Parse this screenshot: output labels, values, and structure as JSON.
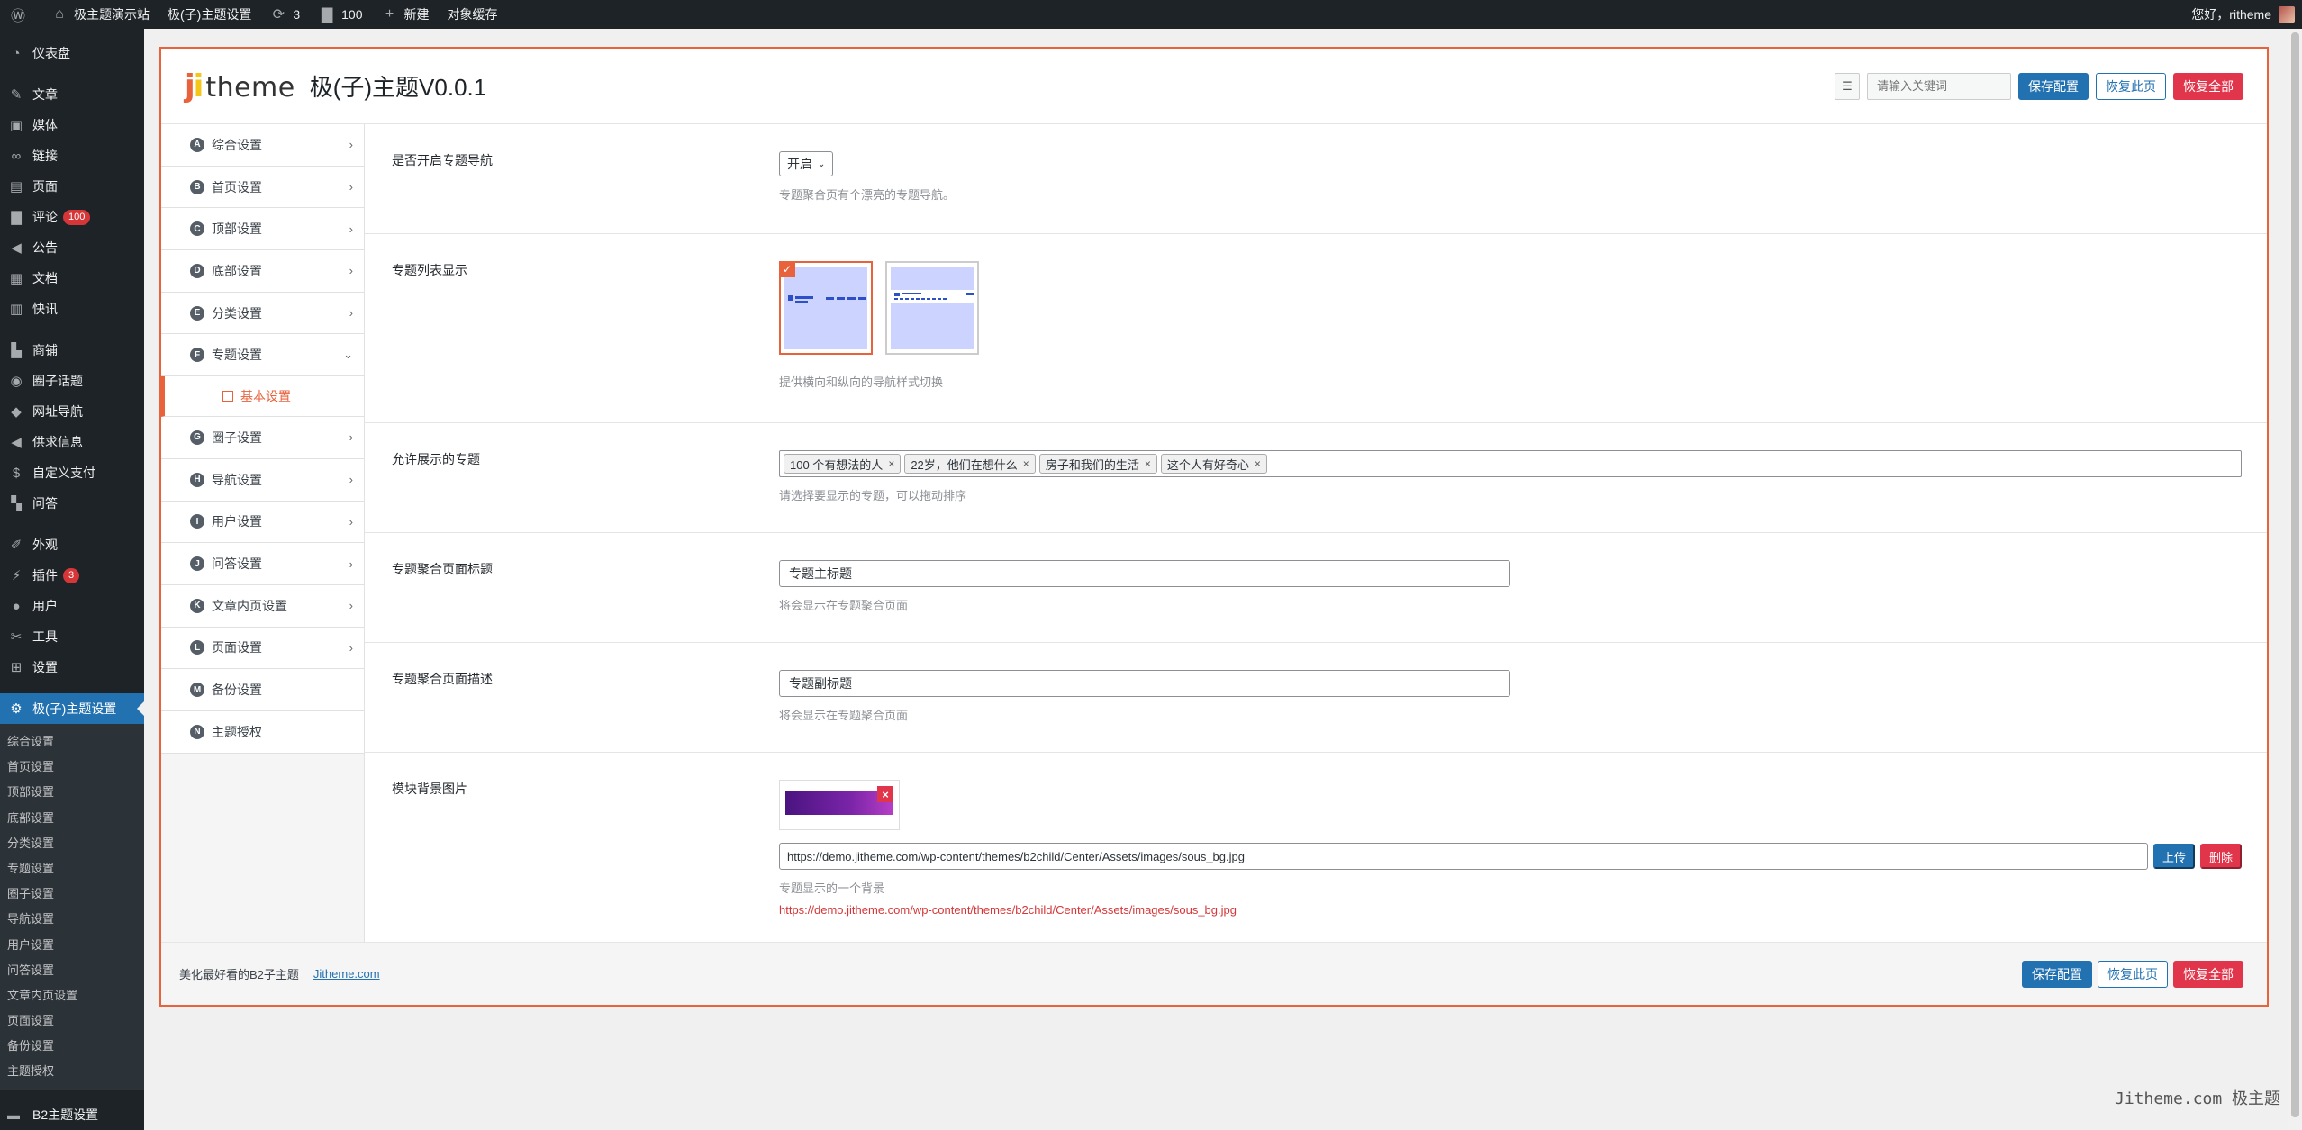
{
  "adminbar": {
    "site_name": "极主题演示站",
    "theme_settings": "极(子)主题设置",
    "updates": "3",
    "comments": "100",
    "new_label": "新建",
    "cache_label": "对象缓存",
    "greeting": "您好，ritheme"
  },
  "menu": {
    "items": [
      {
        "label": "仪表盘",
        "icon": "dashboard-icon"
      },
      {
        "label": "文章",
        "icon": "pin-icon"
      },
      {
        "label": "媒体",
        "icon": "media-icon"
      },
      {
        "label": "链接",
        "icon": "link-icon"
      },
      {
        "label": "页面",
        "icon": "page-icon"
      },
      {
        "label": "评论",
        "icon": "comment-icon",
        "badge": "100"
      },
      {
        "label": "公告",
        "icon": "megaphone-icon"
      },
      {
        "label": "文档",
        "icon": "document-icon"
      },
      {
        "label": "快讯",
        "icon": "flash-icon"
      },
      {
        "label": "商铺",
        "icon": "store-icon"
      },
      {
        "label": "圈子话题",
        "icon": "circle-icon"
      },
      {
        "label": "网址导航",
        "icon": "bus-icon"
      },
      {
        "label": "供求信息",
        "icon": "megaphone-icon"
      },
      {
        "label": "自定义支付",
        "icon": "dollar-icon"
      },
      {
        "label": "问答",
        "icon": "qa-icon"
      },
      {
        "label": "外观",
        "icon": "brush-icon"
      },
      {
        "label": "插件",
        "icon": "plugin-icon",
        "badge": "3"
      },
      {
        "label": "用户",
        "icon": "user-icon"
      },
      {
        "label": "工具",
        "icon": "wrench-icon"
      },
      {
        "label": "设置",
        "icon": "settings-icon"
      }
    ],
    "current": "极(子)主题设置",
    "submenu": [
      "综合设置",
      "首页设置",
      "顶部设置",
      "底部设置",
      "分类设置",
      "专题设置",
      "圈子设置",
      "导航设置",
      "用户设置",
      "问答设置",
      "文章内页设置",
      "页面设置",
      "备份设置",
      "主题授权"
    ],
    "bottom": "B2主题设置"
  },
  "panel": {
    "logo_j": "j",
    "logo_i": "i",
    "logo_text": "theme",
    "title": "极(子)主题V0.0.1",
    "search_placeholder": "请输入关键词",
    "save": "保存配置",
    "restore_page": "恢复此页",
    "restore_all": "恢复全部"
  },
  "nav": {
    "items": [
      {
        "letter": "A",
        "label": "综合设置"
      },
      {
        "letter": "B",
        "label": "首页设置"
      },
      {
        "letter": "C",
        "label": "顶部设置"
      },
      {
        "letter": "D",
        "label": "底部设置"
      },
      {
        "letter": "E",
        "label": "分类设置"
      },
      {
        "letter": "F",
        "label": "专题设置"
      }
    ],
    "sub_active": "基本设置",
    "items_after": [
      {
        "letter": "G",
        "label": "圈子设置"
      },
      {
        "letter": "H",
        "label": "导航设置"
      },
      {
        "letter": "I",
        "label": "用户设置"
      },
      {
        "letter": "J",
        "label": "问答设置"
      },
      {
        "letter": "K",
        "label": "文章内页设置"
      },
      {
        "letter": "L",
        "label": "页面设置"
      },
      {
        "letter": "M",
        "label": "备份设置"
      },
      {
        "letter": "N",
        "label": "主题授权"
      }
    ]
  },
  "fields": {
    "nav_toggle": {
      "label": "是否开启专题导航",
      "value": "开启",
      "desc": "专题聚合页有个漂亮的专题导航。"
    },
    "list_display": {
      "label": "专题列表显示",
      "desc": "提供横向和纵向的导航样式切换"
    },
    "allowed_topics": {
      "label": "允许展示的专题",
      "tags": [
        "100 个有想法的人",
        "22岁，他们在想什么",
        "房子和我们的生活",
        "这个人有好奇心"
      ],
      "desc": "请选择要显示的专题，可以拖动排序"
    },
    "page_title": {
      "label": "专题聚合页面标题",
      "value": "专题主标题",
      "desc": "将会显示在专题聚合页面"
    },
    "page_desc": {
      "label": "专题聚合页面描述",
      "value": "专题副标题",
      "desc": "将会显示在专题聚合页面"
    },
    "bg_image": {
      "label": "模块背景图片",
      "url": "https://demo.jitheme.com/wp-content/themes/b2child/Center/Assets/images/sous_bg.jpg",
      "upload": "上传",
      "delete": "删除",
      "desc": "专题显示的一个背景"
    }
  },
  "footer": {
    "text": "美化最好看的B2子主题",
    "link": "Jitheme.com"
  },
  "watermark": "Jitheme.com 极主题"
}
